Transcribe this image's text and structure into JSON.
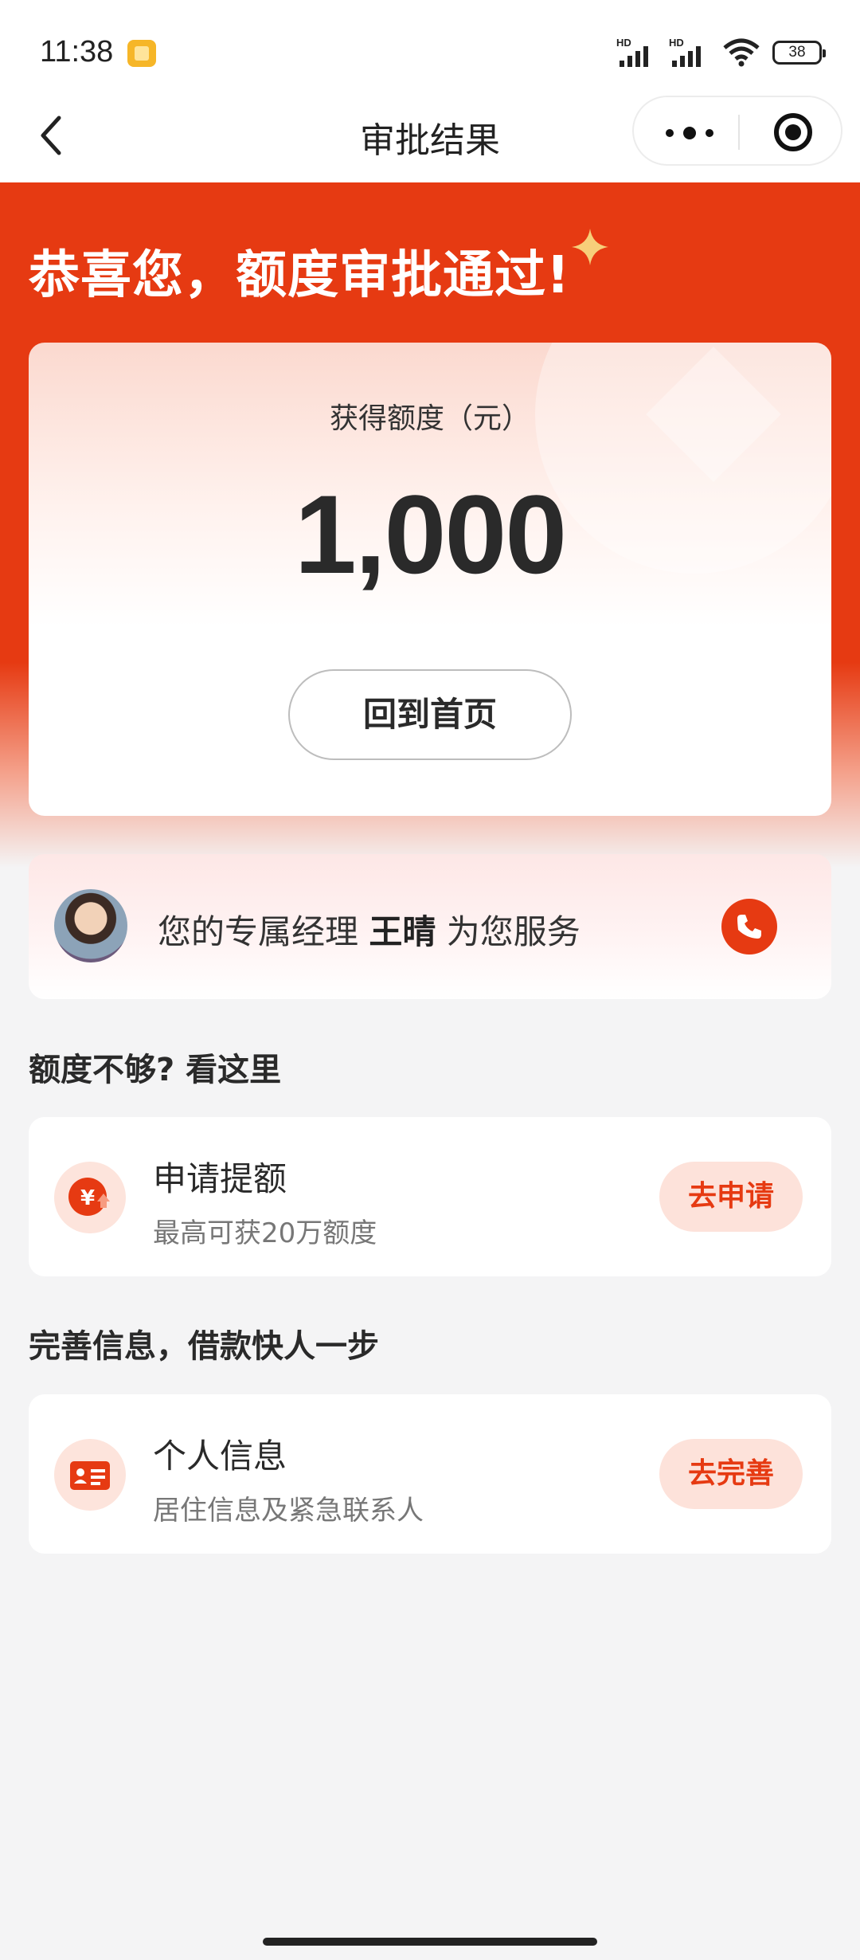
{
  "status_bar": {
    "time": "11:38",
    "battery": "38",
    "signal_label_1": "HD",
    "signal_label_2": "HD"
  },
  "nav": {
    "title": "审批结果",
    "back_icon": "chevron-left-icon",
    "more_icon": "more-dots-icon",
    "close_icon": "target-circle-icon"
  },
  "hero": {
    "title": "恭喜您，额度审批通过!",
    "accent_color": "#e63a12"
  },
  "amount_card": {
    "label": "获得额度（元）",
    "value": "1,000",
    "button_label": "回到首页"
  },
  "manager": {
    "prefix": "您的专属经理",
    "name": "王晴",
    "suffix": "为您服务",
    "phone_icon": "phone-icon"
  },
  "sections": [
    {
      "title": "额度不够? 看这里",
      "card": {
        "icon": "yuan-coin-icon",
        "title": "申请提额",
        "subtitle": "最高可获20万额度",
        "button": "去申请"
      }
    },
    {
      "title": "完善信息，借款快人一步",
      "card": {
        "icon": "id-card-icon",
        "title": "个人信息",
        "subtitle": "居住信息及紧急联系人",
        "button": "去完善"
      }
    }
  ]
}
